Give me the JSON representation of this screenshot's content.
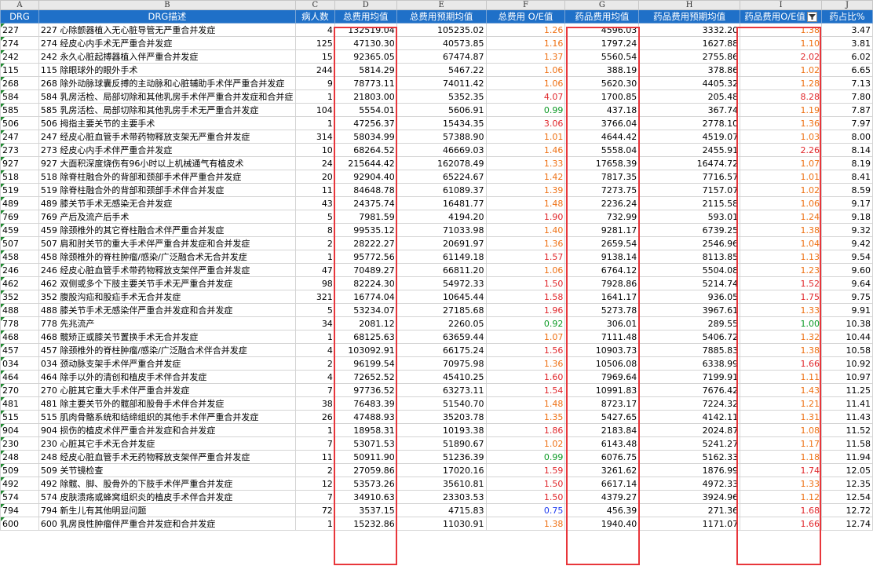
{
  "column_letters": [
    "A",
    "B",
    "C",
    "D",
    "E",
    "F",
    "G",
    "H",
    "I",
    "J"
  ],
  "headers": [
    "DRG",
    "DRG描述",
    "病人数",
    "总费用均值",
    "总费用预期均值",
    "总费用 O/E值",
    "药品费用均值",
    "药品费用预期均值",
    "药品费用O/E值",
    "药占比%"
  ],
  "colors": {
    "header_bg": "#1f70c8",
    "highlight_border": "#e8363b",
    "oe_red": "#e0262a",
    "oe_orange": "#ee7013",
    "oe_green": "#0c9a25",
    "oe_blue": "#1f3cf0"
  },
  "rows": [
    [
      "227",
      "227 心除颤器植入无心脏导管无严重合并发症",
      "4",
      "132519.04",
      "105235.02",
      "1.26",
      "4596.03",
      "3332.20",
      "1.38",
      "3.47"
    ],
    [
      "274",
      "274 经皮心内手术无严重合并发症",
      "125",
      "47130.30",
      "40573.85",
      "1.16",
      "1797.24",
      "1627.88",
      "1.10",
      "3.81"
    ],
    [
      "242",
      "242 永久心脏起搏器植入伴严重合并发症",
      "15",
      "92365.05",
      "67474.87",
      "1.37",
      "5560.54",
      "2755.86",
      "2.02",
      "6.02"
    ],
    [
      "115",
      "115 除眼球外的眼外手术",
      "244",
      "5814.29",
      "5467.22",
      "1.06",
      "388.19",
      "378.86",
      "1.02",
      "6.65"
    ],
    [
      "268",
      "268 除外动脉球囊反搏的主动脉和心脏辅助手术伴严重合并发症",
      "9",
      "78773.11",
      "74011.42",
      "1.06",
      "5620.30",
      "4405.32",
      "1.28",
      "7.13"
    ],
    [
      "584",
      "584 乳房活检、局部切除和其他乳房手术伴严重合并发症和合并症",
      "1",
      "21803.00",
      "5352.35",
      "4.07",
      "1700.85",
      "205.48",
      "8.28",
      "7.80"
    ],
    [
      "585",
      "585 乳房活检、局部切除和其他乳房手术无严重合并发症",
      "104",
      "5554.01",
      "5606.91",
      "0.99",
      "437.18",
      "367.74",
      "1.19",
      "7.87"
    ],
    [
      "506",
      "506 拇指主要关节的主要手术",
      "1",
      "47256.37",
      "15434.35",
      "3.06",
      "3766.04",
      "2778.10",
      "1.36",
      "7.97"
    ],
    [
      "247",
      "247 经皮心脏血管手术带药物释放支架无严重合并发症",
      "314",
      "58034.99",
      "57388.90",
      "1.01",
      "4644.42",
      "4519.07",
      "1.03",
      "8.00"
    ],
    [
      "273",
      "273 经皮心内手术伴严重合并发症",
      "10",
      "68264.52",
      "46669.03",
      "1.46",
      "5558.04",
      "2455.91",
      "2.26",
      "8.14"
    ],
    [
      "927",
      "927 大面积深度烧伤有96小时以上机械通气有植皮术",
      "24",
      "215644.42",
      "162078.49",
      "1.33",
      "17658.39",
      "16474.72",
      "1.07",
      "8.19"
    ],
    [
      "518",
      "518 除脊柱融合外的背部和颈部手术伴严重合并发症",
      "20",
      "92904.40",
      "65224.67",
      "1.42",
      "7817.35",
      "7716.57",
      "1.01",
      "8.41"
    ],
    [
      "519",
      "519 除脊柱融合外的背部和颈部手术伴合并发症",
      "11",
      "84648.78",
      "61089.37",
      "1.39",
      "7273.75",
      "7157.07",
      "1.02",
      "8.59"
    ],
    [
      "489",
      "489 膝关节手术无感染无合并发症",
      "43",
      "24375.74",
      "16481.77",
      "1.48",
      "2236.24",
      "2115.58",
      "1.06",
      "9.17"
    ],
    [
      "769",
      "769 产后及流产后手术",
      "5",
      "7981.59",
      "4194.20",
      "1.90",
      "732.99",
      "593.01",
      "1.24",
      "9.18"
    ],
    [
      "459",
      "459 除颈椎外的其它脊柱融合术伴严重合并发症",
      "8",
      "99535.12",
      "71033.98",
      "1.40",
      "9281.17",
      "6739.25",
      "1.38",
      "9.32"
    ],
    [
      "507",
      "507 肩和肘关节的重大手术伴严重合并发症和合并发症",
      "2",
      "28222.27",
      "20691.97",
      "1.36",
      "2659.54",
      "2546.96",
      "1.04",
      "9.42"
    ],
    [
      "458",
      "458 除颈椎外的脊柱肿瘤/感染/广泛融合术无合并发症",
      "1",
      "95772.56",
      "61149.18",
      "1.57",
      "9138.14",
      "8113.85",
      "1.13",
      "9.54"
    ],
    [
      "246",
      "246 经皮心脏血管手术带药物释放支架伴严重合并发症",
      "47",
      "70489.27",
      "66811.20",
      "1.06",
      "6764.12",
      "5504.08",
      "1.23",
      "9.60"
    ],
    [
      "462",
      "462 双侧或多个下肢主要关节手术无严重合并发症",
      "98",
      "82224.30",
      "54972.33",
      "1.50",
      "7928.86",
      "5214.74",
      "1.52",
      "9.64"
    ],
    [
      "352",
      "352 腹股沟疝和股疝手术无合并发症",
      "321",
      "16774.04",
      "10645.44",
      "1.58",
      "1641.17",
      "936.05",
      "1.75",
      "9.75"
    ],
    [
      "488",
      "488 膝关节手术无感染伴严重合并发症和合并发症",
      "5",
      "53234.07",
      "27185.68",
      "1.96",
      "5273.78",
      "3967.61",
      "1.33",
      "9.91"
    ],
    [
      "778",
      "778 先兆流产",
      "34",
      "2081.12",
      "2260.05",
      "0.92",
      "306.01",
      "289.55",
      "1.00",
      "10.38"
    ],
    [
      "468",
      "468 髋矫正或膝关节置换手术无合并发症",
      "1",
      "68125.63",
      "63659.44",
      "1.07",
      "7111.48",
      "5406.72",
      "1.32",
      "10.44"
    ],
    [
      "457",
      "457 除颈椎外的脊柱肿瘤/感染/广泛融合术伴合并发症",
      "4",
      "103092.91",
      "66175.24",
      "1.56",
      "10903.73",
      "7885.83",
      "1.38",
      "10.58"
    ],
    [
      "034",
      "034 颈动脉支架手术伴严重合并发症",
      "2",
      "96199.54",
      "70975.98",
      "1.36",
      "10506.08",
      "6338.99",
      "1.66",
      "10.92"
    ],
    [
      "464",
      "464 除手以外的清创和植皮手术伴合并发症",
      "4",
      "72652.52",
      "45410.25",
      "1.60",
      "7969.64",
      "7199.91",
      "1.11",
      "10.97"
    ],
    [
      "270",
      "270 心脏其它重大手术伴严重合并发症",
      "7",
      "97736.52",
      "63273.11",
      "1.54",
      "10991.83",
      "7676.42",
      "1.43",
      "11.25"
    ],
    [
      "481",
      "481 除主要关节外的髋部和股骨手术伴合并发症",
      "38",
      "76483.39",
      "51540.70",
      "1.48",
      "8723.17",
      "7224.32",
      "1.21",
      "11.41"
    ],
    [
      "515",
      "515 肌肉骨骼系统和结缔组织的其他手术伴严重合并发症",
      "26",
      "47488.93",
      "35203.78",
      "1.35",
      "5427.65",
      "4142.11",
      "1.31",
      "11.43"
    ],
    [
      "904",
      "904 损伤的植皮术伴严重合并发症和合并发症",
      "1",
      "18958.31",
      "10193.38",
      "1.86",
      "2183.84",
      "2024.87",
      "1.08",
      "11.52"
    ],
    [
      "230",
      "230 心脏其它手术无合并发症",
      "7",
      "53071.53",
      "51890.67",
      "1.02",
      "6143.48",
      "5241.27",
      "1.17",
      "11.58"
    ],
    [
      "248",
      "248 经皮心脏血管手术无药物释放支架伴严重合并发症",
      "11",
      "50911.90",
      "51236.39",
      "0.99",
      "6076.75",
      "5162.33",
      "1.18",
      "11.94"
    ],
    [
      "509",
      "509 关节镜检查",
      "2",
      "27059.86",
      "17020.16",
      "1.59",
      "3261.62",
      "1876.99",
      "1.74",
      "12.05"
    ],
    [
      "492",
      "492 除髋、脚、股骨外的下肢手术伴严重合并发症",
      "12",
      "53573.26",
      "35610.81",
      "1.50",
      "6617.14",
      "4972.33",
      "1.33",
      "12.35"
    ],
    [
      "574",
      "574 皮肤溃疡或蜂窝组织炎的植皮手术伴合并发症",
      "7",
      "34910.63",
      "23303.53",
      "1.50",
      "4379.27",
      "3924.96",
      "1.12",
      "12.54"
    ],
    [
      "794",
      "794 新生儿有其他明显问题",
      "72",
      "3537.15",
      "4715.83",
      "0.75",
      "456.39",
      "271.36",
      "1.68",
      "12.72"
    ],
    [
      "600",
      "600 乳房良性肿瘤伴严重合并发症和合并发症",
      "1",
      "15232.86",
      "11030.91",
      "1.38",
      "1940.40",
      "1171.07",
      "1.66",
      "12.74"
    ]
  ]
}
